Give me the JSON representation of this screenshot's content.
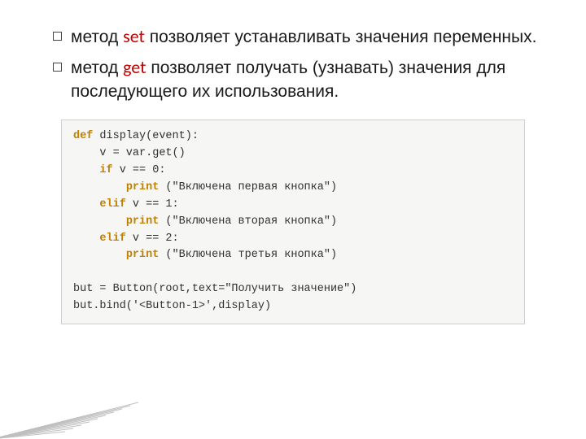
{
  "bullets": [
    {
      "pre": "метод ",
      "kw": "set",
      "post": " позволяет устанавливать значения переменных."
    },
    {
      "pre": "метод ",
      "kw": "get",
      "post": " позволяет получать (узнавать) значения для последующего их использования."
    }
  ],
  "code": {
    "l1_kw": "def",
    "l1_rest": " display(event):",
    "l2": "    v = var.get()",
    "l3_kw": "if",
    "l3_rest": " v == 0:",
    "l4_kw": "print",
    "l4_rest": " (\"Включена первая кнопка\")",
    "l5_kw": "elif",
    "l5_rest": " v == 1:",
    "l6_kw": "print",
    "l6_rest": " (\"Включена вторая кнопка\")",
    "l7_kw": "elif",
    "l7_rest": " v == 2:",
    "l8_kw": "print",
    "l8_rest": " (\"Включена третья кнопка\")",
    "l9": "",
    "l10": "but = Button(root,text=\"Получить значение\")",
    "l11": "but.bind('<Button-1>',display)"
  }
}
